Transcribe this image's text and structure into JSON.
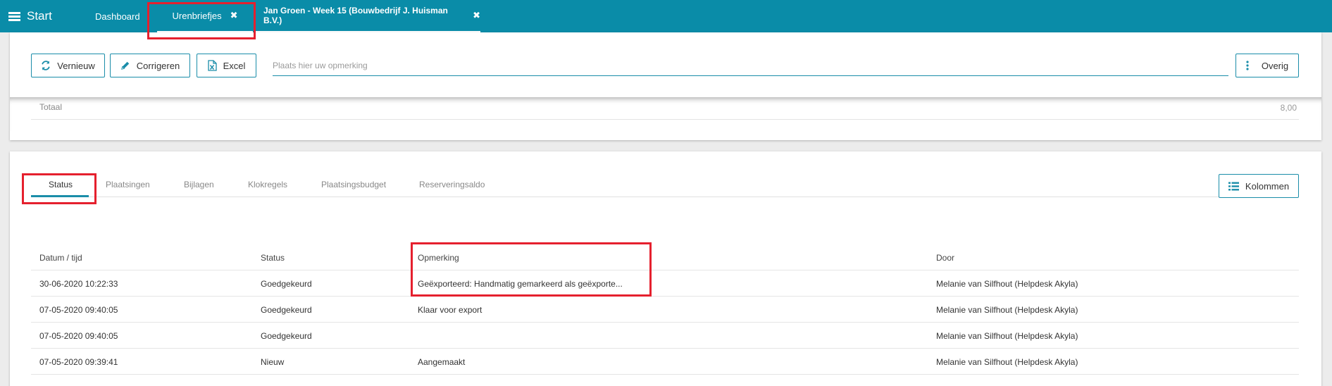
{
  "colors": {
    "topbar": "#0a8ca8",
    "accent": "#1a8da9",
    "highlight": "#e5202e"
  },
  "topbar": {
    "start_label": "Start",
    "menu_icon": "hamburger-icon",
    "tabs": [
      {
        "label": "Dashboard"
      },
      {
        "label": "Urenbriefjes",
        "close": "✖"
      },
      {
        "label": "Jan Groen - Week 15 (Bouwbedrijf J. Huisman B.V.)",
        "close": "✖"
      }
    ]
  },
  "toolbar": {
    "vernieuw_label": "Vernieuw",
    "vernieuw_icon": "refresh-icon",
    "corrigeren_label": "Corrigeren",
    "corrigeren_icon": "pencil-icon",
    "excel_label": "Excel",
    "excel_icon": "excel-file-icon",
    "remark_placeholder": "Plaats hier uw opmerking",
    "overig_label": "Overig",
    "overig_icon": "vertical-dots-icon"
  },
  "summary": {
    "totaal_label": "Totaal",
    "totaal_value": "8,00"
  },
  "detail": {
    "tabs": [
      {
        "label": "Status",
        "active": true
      },
      {
        "label": "Plaatsingen"
      },
      {
        "label": "Bijlagen"
      },
      {
        "label": "Klokregels"
      },
      {
        "label": "Plaatsingsbudget"
      },
      {
        "label": "Reserveringsaldo"
      }
    ],
    "kolommen_label": "Kolommen",
    "kolommen_icon": "list-icon",
    "columns": [
      "Datum / tijd",
      "Status",
      "Opmerking",
      "Door"
    ],
    "rows": [
      {
        "datum": "30-06-2020 10:22:33",
        "status": "Goedgekeurd",
        "opmerking": "Geëxporteerd: Handmatig gemarkeerd als geëxporte...",
        "door": "Melanie van Silfhout (Helpdesk Akyla)"
      },
      {
        "datum": "07-05-2020 09:40:05",
        "status": "Goedgekeurd",
        "opmerking": "Klaar voor export",
        "door": "Melanie van Silfhout (Helpdesk Akyla)"
      },
      {
        "datum": "07-05-2020 09:40:05",
        "status": "Goedgekeurd",
        "opmerking": "",
        "door": "Melanie van Silfhout (Helpdesk Akyla)"
      },
      {
        "datum": "07-05-2020 09:39:41",
        "status": "Nieuw",
        "opmerking": "Aangemaakt",
        "door": "Melanie van Silfhout (Helpdesk Akyla)"
      }
    ]
  }
}
